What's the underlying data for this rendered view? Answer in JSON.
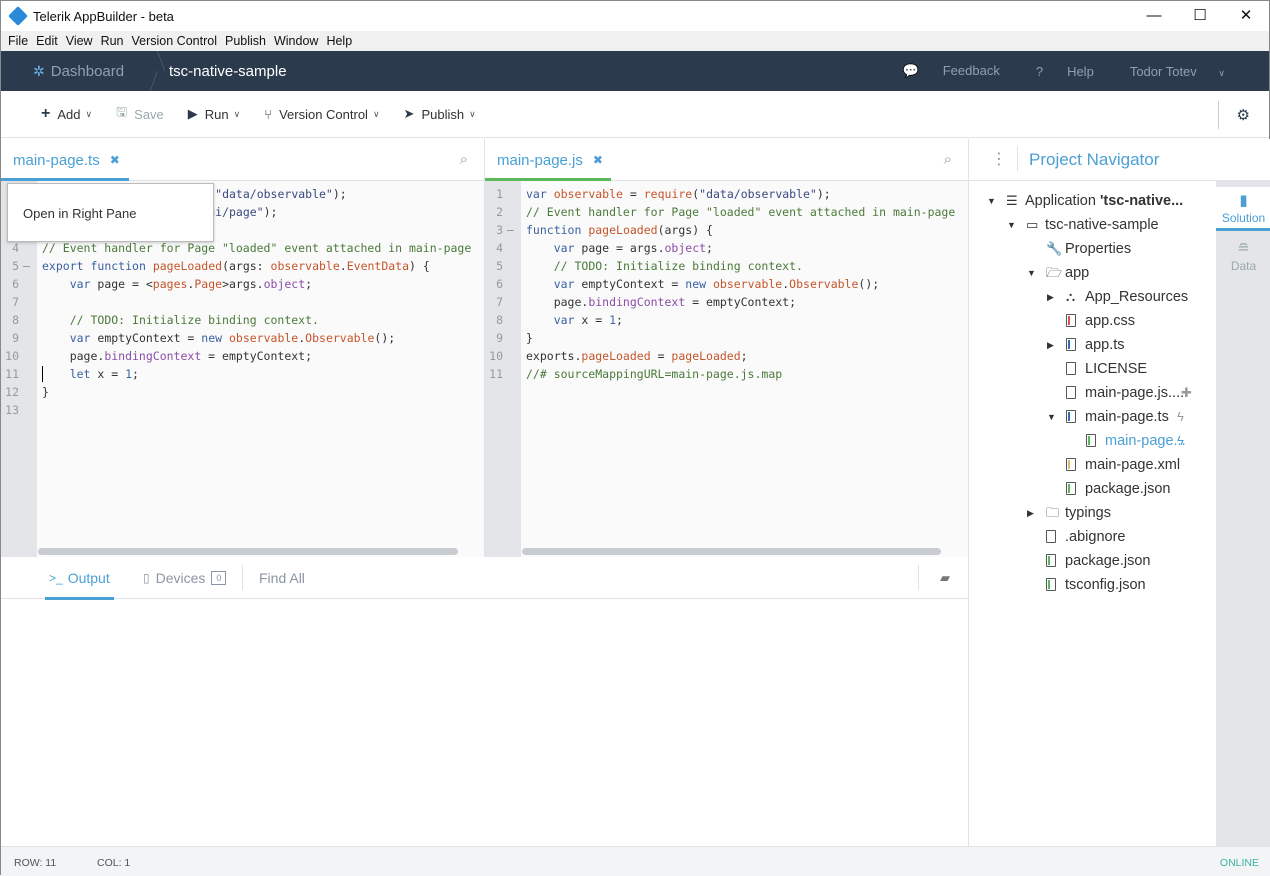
{
  "window": {
    "title": "Telerik AppBuilder - beta",
    "minimize": "—",
    "maximize": "☐",
    "close": "✕"
  },
  "menu": [
    "File",
    "Edit",
    "View",
    "Run",
    "Version Control",
    "Publish",
    "Window",
    "Help"
  ],
  "navbar": {
    "dashboard": "Dashboard",
    "project": "tsc-native-sample",
    "feedback": "Feedback",
    "help": "Help",
    "user": "Todor Totev"
  },
  "toolbar": {
    "add": "Add",
    "save": "Save",
    "run": "Run",
    "version_control": "Version Control",
    "publish": "Publish"
  },
  "left_editor": {
    "tab": "main-page.ts",
    "context_menu": [
      "Open in Right Pane"
    ],
    "lines": [
      "var observable = require(\"data/observable\");",
      "import pages = require(\"ui/page\");",
      "",
      "// Event handler for Page \"loaded\" event attached in main-page",
      "export function pageLoaded(args: observable.EventData) {",
      "    var page = <pages.Page>args.object;",
      "",
      "    // TODO: Initialize binding context.",
      "    var emptyContext = new observable.Observable();",
      "    page.bindingContext = emptyContext;",
      "    let x = 1;",
      "}",
      ""
    ]
  },
  "right_editor": {
    "tab": "main-page.js",
    "lines": [
      "var observable = require(\"data/observable\");",
      "// Event handler for Page \"loaded\" event attached in main-page",
      "function pageLoaded(args) {",
      "    var page = args.object;",
      "    // TODO: Initialize binding context.",
      "    var emptyContext = new observable.Observable();",
      "    page.bindingContext = emptyContext;",
      "    var x = 1;",
      "}",
      "exports.pageLoaded = pageLoaded;",
      "//# sourceMappingURL=main-page.js.map"
    ]
  },
  "bottom": {
    "output": "Output",
    "devices": "Devices",
    "devices_count": "0",
    "find_all": "Find All"
  },
  "navigator": {
    "title": "Project Navigator",
    "side_tabs": [
      "Solution",
      "Data"
    ],
    "tree": [
      {
        "label": "Application ",
        "bold": "'tsc-native...",
        "depth": 0,
        "arrow": "down",
        "icon": "application"
      },
      {
        "label": "tsc-native-sample",
        "depth": 1,
        "arrow": "down",
        "icon": "project"
      },
      {
        "label": "Properties",
        "depth": 2,
        "arrow": "",
        "icon": "wrench"
      },
      {
        "label": "app",
        "depth": 2,
        "arrow": "down",
        "icon": "folder-open"
      },
      {
        "label": "App_Resources",
        "depth": 3,
        "arrow": "right",
        "icon": "sitemap"
      },
      {
        "label": "app.css",
        "depth": 3,
        "arrow": "",
        "icon": "file-css"
      },
      {
        "label": "app.ts",
        "depth": 3,
        "arrow": "right",
        "icon": "file-ts"
      },
      {
        "label": "LICENSE",
        "depth": 3,
        "arrow": "",
        "icon": "file"
      },
      {
        "label": "main-page.js....",
        "depth": 3,
        "arrow": "",
        "icon": "file",
        "action": "plus"
      },
      {
        "label": "main-page.ts",
        "depth": 3,
        "arrow": "down",
        "icon": "file-ts",
        "action": "bolt"
      },
      {
        "label": "main-page...",
        "depth": 4,
        "arrow": "",
        "icon": "file-js",
        "action": "bolt",
        "selected": true
      },
      {
        "label": "main-page.xml",
        "depth": 3,
        "arrow": "",
        "icon": "file-xml"
      },
      {
        "label": "package.json",
        "depth": 3,
        "arrow": "",
        "icon": "file-json"
      },
      {
        "label": "typings",
        "depth": 2,
        "arrow": "right",
        "icon": "folder"
      },
      {
        "label": ".abignore",
        "depth": 2,
        "arrow": "",
        "icon": "file"
      },
      {
        "label": "package.json",
        "depth": 2,
        "arrow": "",
        "icon": "file-json"
      },
      {
        "label": "tsconfig.json",
        "depth": 2,
        "arrow": "",
        "icon": "file-json"
      }
    ]
  },
  "status": {
    "row": "ROW: 11",
    "col": "COL: 1",
    "connection": "ONLINE"
  },
  "colors": {
    "accent": "#4a9fd5",
    "navbar": "#2b3a4d",
    "js_tab": "#5cb85c",
    "online": "#3bb3a0"
  }
}
